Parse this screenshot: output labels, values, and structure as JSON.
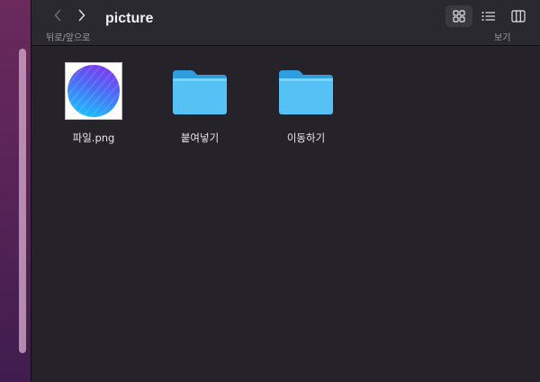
{
  "window": {
    "title": "picture",
    "nav_caption": "뒤로/앞으로",
    "view_caption": "보기"
  },
  "toolbar": {
    "back_icon": "chevron-left-icon",
    "forward_icon": "chevron-right-icon",
    "view_modes": [
      "icon-grid-icon",
      "list-icon",
      "columns-icon"
    ],
    "active_view": "icon-grid-icon"
  },
  "files": [
    {
      "name": "파일.png",
      "kind": "image"
    },
    {
      "name": "붙여넣기",
      "kind": "folder"
    },
    {
      "name": "이동하기",
      "kind": "folder"
    }
  ],
  "colors": {
    "window_bg": "#252329",
    "toolbar_bg": "#2b2930",
    "folder_blue": "#56c1f5",
    "desktop_accent": "#6a2a5c"
  }
}
